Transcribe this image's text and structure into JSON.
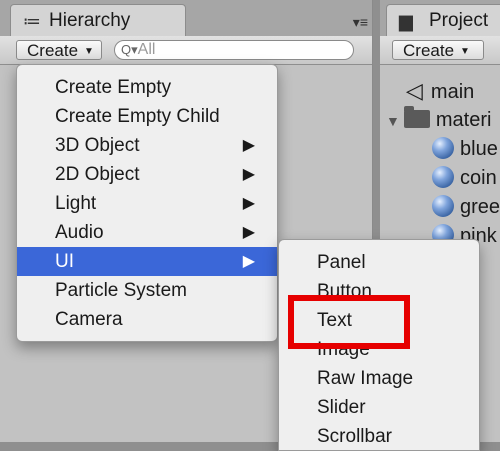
{
  "hierarchy": {
    "tab_icon": "≔",
    "title": "Hierarchy",
    "menu_icon": "▾≡",
    "create_label": "Create",
    "search_placeholder": "All",
    "search_icon": "Q▾"
  },
  "project": {
    "tab_icon": "▆",
    "title": "Project",
    "create_label": "Create",
    "items": [
      {
        "label": "main",
        "icon": "unity-icon"
      },
      {
        "label": "materi",
        "icon": "folder-icon"
      },
      {
        "label": "blue",
        "icon": "sphere-icon"
      },
      {
        "label": "coin",
        "icon": "sphere-icon"
      },
      {
        "label": "gree",
        "icon": "sphere-icon"
      },
      {
        "label": "pink",
        "icon": "sphere-icon"
      }
    ]
  },
  "create_menu": {
    "items": [
      {
        "label": "Create Empty",
        "submenu": false
      },
      {
        "label": "Create Empty Child",
        "submenu": false
      },
      {
        "label": "3D Object",
        "submenu": true
      },
      {
        "label": "2D Object",
        "submenu": true
      },
      {
        "label": "Light",
        "submenu": true
      },
      {
        "label": "Audio",
        "submenu": true
      },
      {
        "label": "UI",
        "submenu": true,
        "selected": true
      },
      {
        "label": "Particle System",
        "submenu": false
      },
      {
        "label": "Camera",
        "submenu": false
      }
    ],
    "arrow_glyph": "▶"
  },
  "ui_submenu": {
    "items": [
      "Panel",
      "Button",
      "Text",
      "Image",
      "Raw Image",
      "Slider",
      "Scrollbar"
    ]
  },
  "colors": {
    "selection": "#3b67d8",
    "highlight_box": "#e60000"
  }
}
